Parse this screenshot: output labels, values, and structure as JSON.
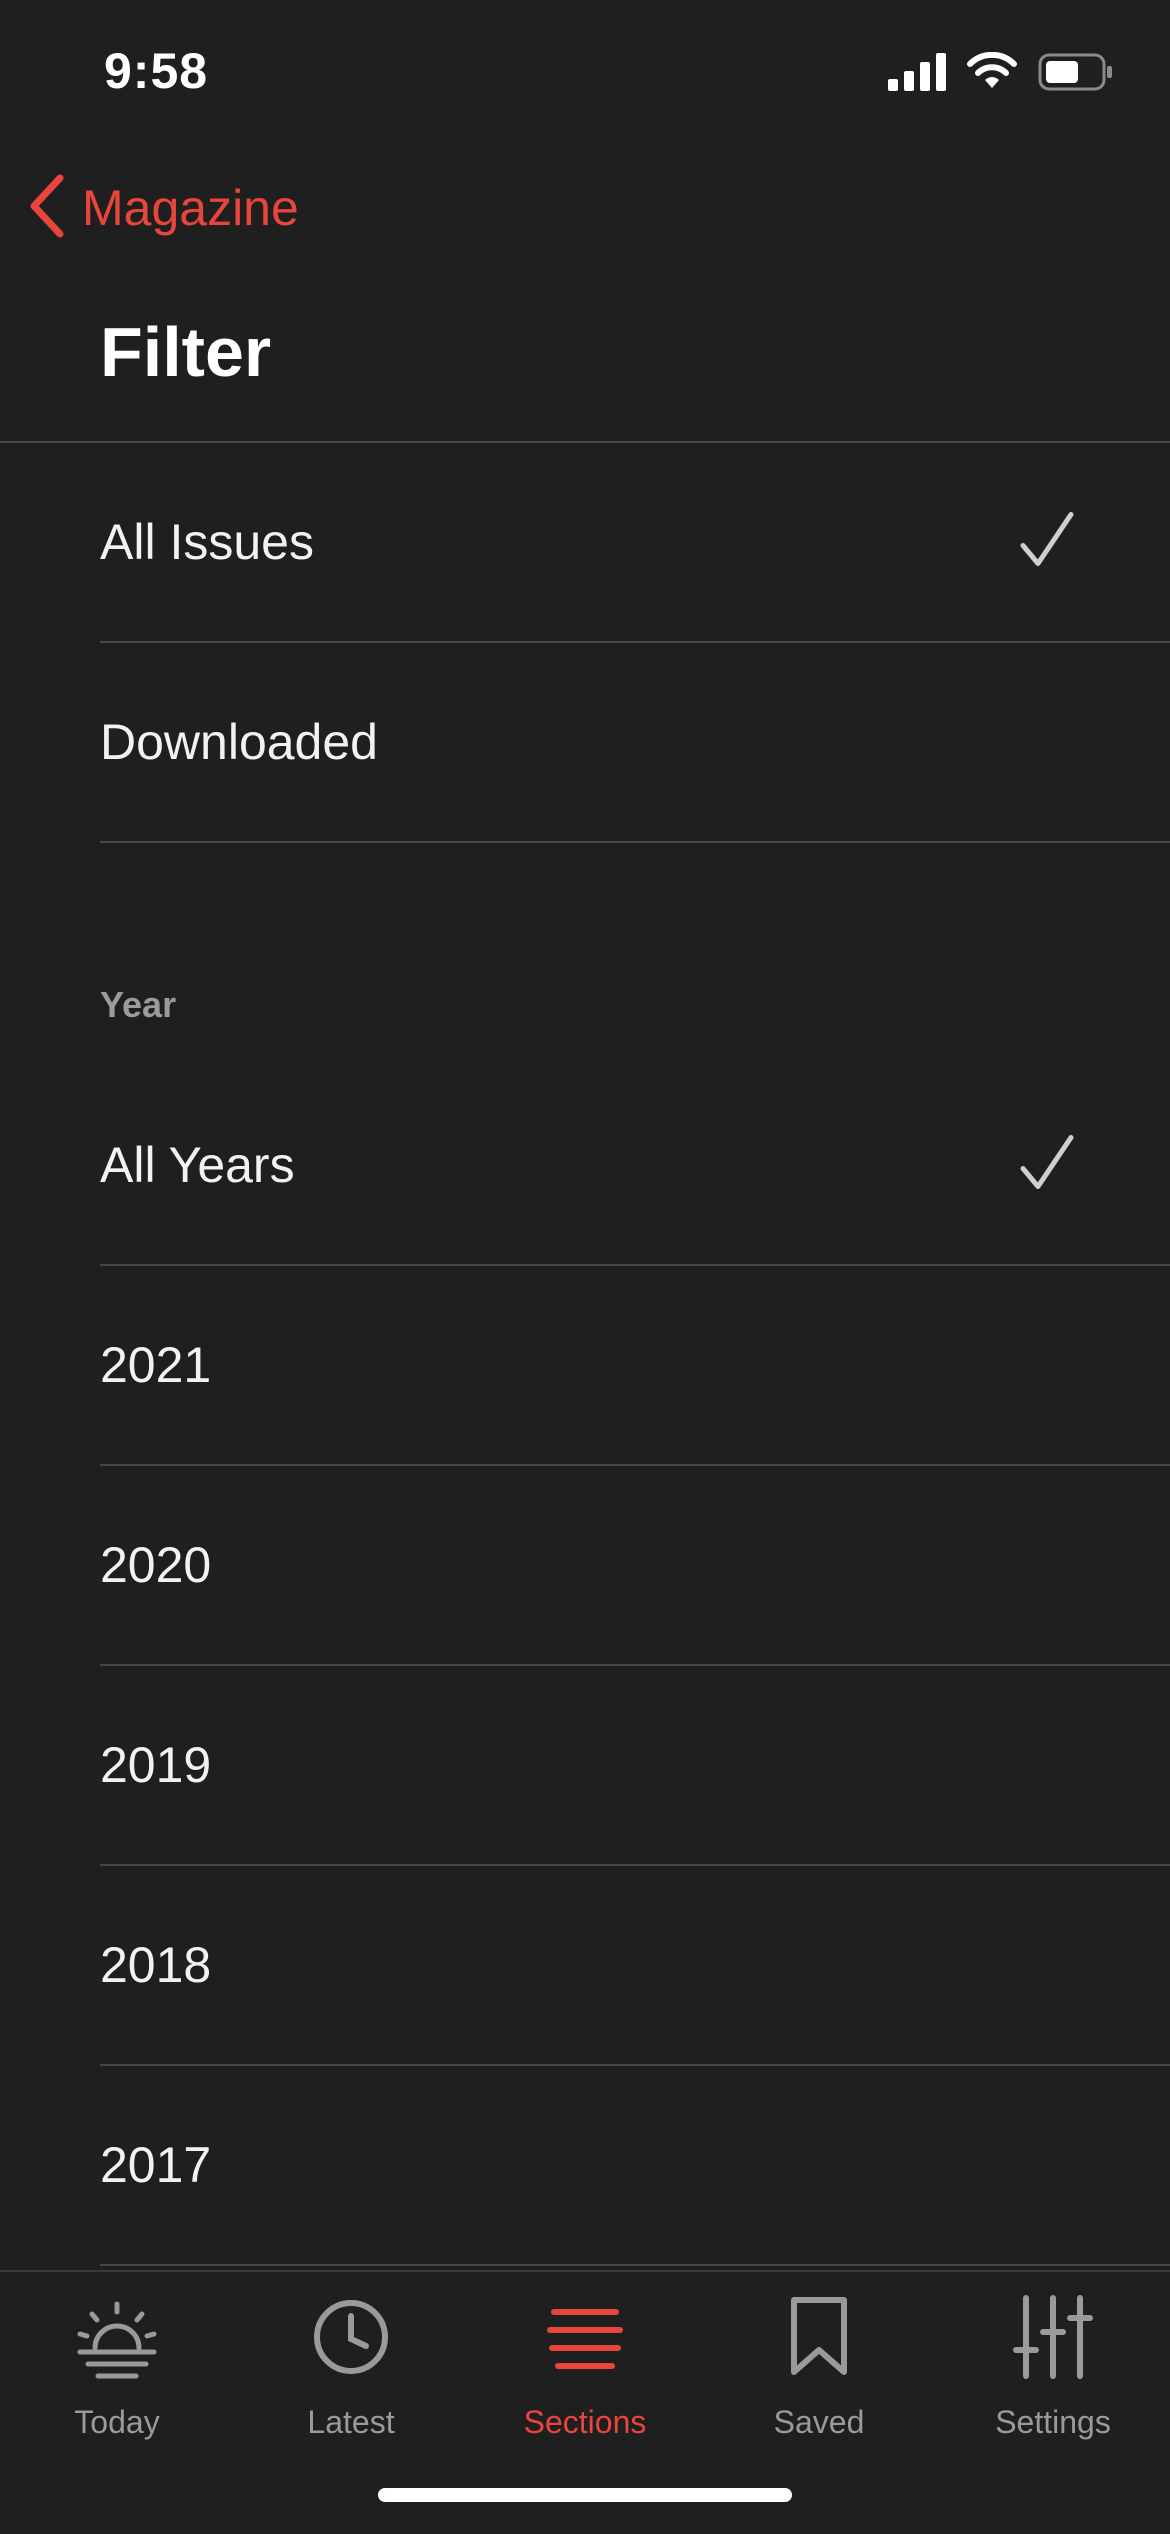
{
  "status_bar": {
    "time": "9:58",
    "icons": [
      "cellular-signal-icon",
      "wifi-icon",
      "battery-icon"
    ]
  },
  "nav": {
    "back_label": "Magazine",
    "title": "Filter"
  },
  "issue_filter": [
    {
      "label": "All Issues",
      "selected": true
    },
    {
      "label": "Downloaded",
      "selected": false
    }
  ],
  "year_filter": {
    "header": "Year",
    "options": [
      {
        "label": "All Years",
        "selected": true
      },
      {
        "label": "2021",
        "selected": false
      },
      {
        "label": "2020",
        "selected": false
      },
      {
        "label": "2019",
        "selected": false
      },
      {
        "label": "2018",
        "selected": false
      },
      {
        "label": "2017",
        "selected": false
      }
    ]
  },
  "tab_bar": [
    {
      "label": "Today",
      "icon": "sunrise-icon",
      "active": false
    },
    {
      "label": "Latest",
      "icon": "clock-icon",
      "active": false
    },
    {
      "label": "Sections",
      "icon": "sections-lines-icon",
      "active": true
    },
    {
      "label": "Saved",
      "icon": "bookmark-icon",
      "active": false
    },
    {
      "label": "Settings",
      "icon": "sliders-icon",
      "active": false
    }
  ],
  "colors": {
    "background": "#1f1f1f",
    "accent": "#e8453c",
    "divider": "#474747",
    "checkmark": "#cfcfcf",
    "inactive_tab": "#9a9a9a"
  }
}
